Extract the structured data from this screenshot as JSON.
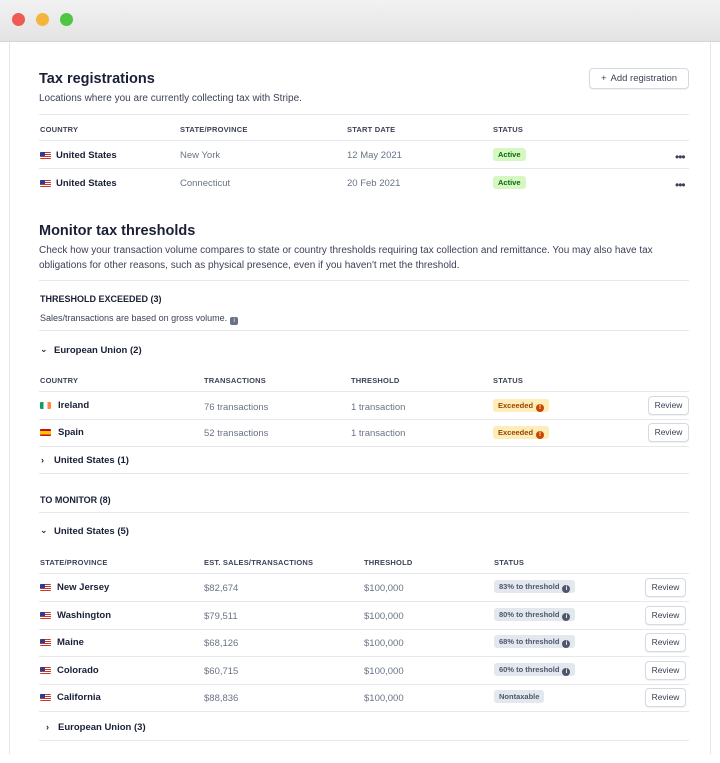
{
  "window": {
    "colors": {
      "close": "#ee5b54",
      "minimize": "#f3b53b",
      "zoom": "#4fc544"
    }
  },
  "registrations": {
    "title": "Tax registrations",
    "subtitle": "Locations where you are currently collecting tax with Stripe.",
    "add_button": "Add registration",
    "add_icon": "+",
    "columns": [
      "COUNTRY",
      "STATE/PROVINCE",
      "START DATE",
      "STATUS"
    ],
    "rows": [
      {
        "country": "United States",
        "state": "New York",
        "start_date": "12 May 2021",
        "status": "Active"
      },
      {
        "country": "United States",
        "state": "Connecticut",
        "start_date": "20 Feb 2021",
        "status": "Active"
      }
    ],
    "more_icon": "•••"
  },
  "monitor": {
    "title": "Monitor tax thresholds",
    "description_line1": "Check how your transaction volume compares to state or country thresholds requiring tax collection and remittance. You may also have tax",
    "description_line2": "obligations for other reasons, such as physical presence, even if you haven't met the threshold.",
    "exceeded_heading": "THRESHOLD EXCEEDED (3)",
    "exceeded_note": "Sales/transactions are based on gross volume.",
    "eu_group": "European Union (2)",
    "exceeded_columns": [
      "COUNTRY",
      "TRANSACTIONS",
      "THRESHOLD",
      "STATUS"
    ],
    "exceeded_rows": [
      {
        "country": "Ireland",
        "transactions": "76 transactions",
        "threshold": "1 transaction",
        "status": "Exceeded"
      },
      {
        "country": "Spain",
        "transactions": "52 transactions",
        "threshold": "1 transaction",
        "status": "Exceeded"
      }
    ],
    "us_collapsed": "United States (1)",
    "to_monitor_heading": "TO MONITOR (8)",
    "us_group": "United States (5)",
    "monitor_columns": [
      "STATE/PROVINCE",
      "EST. SALES/TRANSACTIONS",
      "THRESHOLD",
      "STATUS"
    ],
    "monitor_rows": [
      {
        "state": "New Jersey",
        "sales": "$82,674",
        "threshold": "$100,000",
        "status": "83% to threshold"
      },
      {
        "state": "Washington",
        "sales": "$79,511",
        "threshold": "$100,000",
        "status": "80% to threshold"
      },
      {
        "state": "Maine",
        "sales": "$68,126",
        "threshold": "$100,000",
        "status": "68% to threshold"
      },
      {
        "state": "Colorado",
        "sales": "$60,715",
        "threshold": "$100,000",
        "status": "60% to threshold"
      },
      {
        "state": "California",
        "sales": "$88,836",
        "threshold": "$100,000",
        "status": "Nontaxable"
      }
    ],
    "eu_collapsed": "European Union (3)",
    "review_label": "Review",
    "exceeded_icon": "!",
    "info_icon": "i"
  },
  "colors": {
    "active_bg": "#d7f7c2",
    "active_text": "#05690d",
    "exceeded_bg": "#fcedb9",
    "exceeded_text": "#a04100",
    "neutral_bg": "#e3e8ee"
  }
}
